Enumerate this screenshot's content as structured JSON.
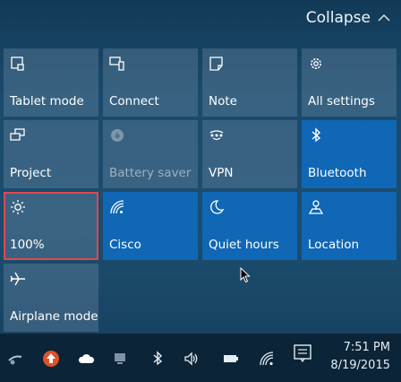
{
  "header": {
    "collapse_label": "Collapse"
  },
  "tiles": [
    {
      "label": "Tablet mode",
      "icon": "tablet-mode-icon",
      "state": "off"
    },
    {
      "label": "Connect",
      "icon": "connect-icon",
      "state": "off"
    },
    {
      "label": "Note",
      "icon": "note-icon",
      "state": "off"
    },
    {
      "label": "All settings",
      "icon": "settings-gear-icon",
      "state": "off"
    },
    {
      "label": "Project",
      "icon": "project-icon",
      "state": "off"
    },
    {
      "label": "Battery saver",
      "icon": "battery-saver-icon",
      "state": "disabled"
    },
    {
      "label": "VPN",
      "icon": "vpn-icon",
      "state": "off"
    },
    {
      "label": "Bluetooth",
      "icon": "bluetooth-icon",
      "state": "on"
    },
    {
      "label": "100%",
      "icon": "brightness-icon",
      "state": "off-selected"
    },
    {
      "label": "Cisco",
      "icon": "wifi-icon",
      "state": "on"
    },
    {
      "label": "Quiet hours",
      "icon": "moon-icon",
      "state": "on"
    },
    {
      "label": "Location",
      "icon": "location-icon",
      "state": "on"
    },
    {
      "label": "Airplane mode",
      "icon": "airplane-icon",
      "state": "off"
    }
  ],
  "taskbar": {
    "time": "7:51 PM",
    "date": "8/19/2015",
    "tray_icons": [
      "network-adapter-icon",
      "red-up-arrow-icon",
      "cloud-icon",
      "monitor-icon",
      "bluetooth-icon",
      "volume-icon",
      "battery-icon",
      "wifi-icon",
      "notification-icon"
    ]
  },
  "colors": {
    "tile_on": "#0f67b5",
    "tile_off": "#4a6f8c",
    "selected_border": "#e2464e",
    "taskbar": "#0b2437"
  }
}
